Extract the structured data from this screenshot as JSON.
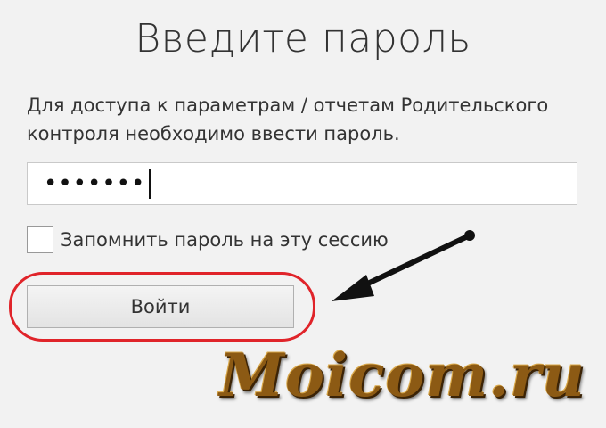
{
  "dialog": {
    "title": "Введите пароль",
    "description": "Для доступа к параметрам / отчетам Родительского контроля необходимо ввести пароль.",
    "password": {
      "masked_value": "•••••••",
      "length": 7
    },
    "remember": {
      "label": "Запомнить пароль на эту сессию",
      "checked": false
    },
    "login_button_label": "Войти"
  },
  "annotations": {
    "highlight_color": "#e0242a",
    "arrow_color": "#111111"
  },
  "watermark": {
    "text": "Moicom.ru"
  }
}
